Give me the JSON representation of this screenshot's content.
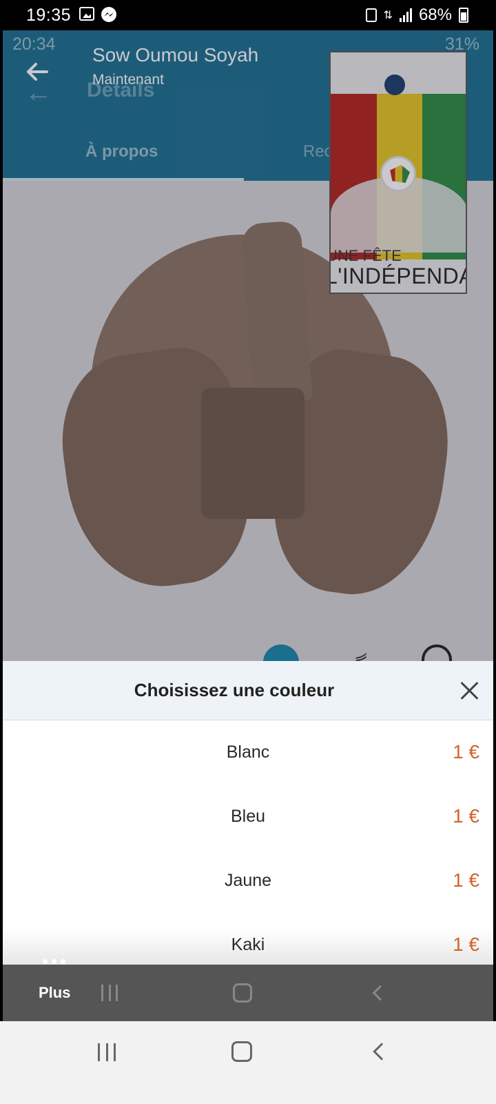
{
  "status_bar": {
    "time": "19:35",
    "battery": "68%",
    "icons": [
      "gallery-icon",
      "messenger-icon",
      "lock-icon",
      "data-icon",
      "signal-icon",
      "battery-icon"
    ]
  },
  "background_app": {
    "time": "20:34",
    "status_right": "31%",
    "header_title": "Details",
    "tabs": [
      "À propos",
      "Rec"
    ],
    "accent_color": "#1a6e8e"
  },
  "notification": {
    "sender": "Sow Oumou Soyah",
    "time": "Maintenant"
  },
  "pip_video": {
    "line1": "UNE FÊTE",
    "line2": "L'INDÉPENDAN"
  },
  "sheet": {
    "title": "Choisissez une couleur",
    "options": [
      {
        "name": "Blanc",
        "price": "1 €"
      },
      {
        "name": "Bleu",
        "price": "1 €"
      },
      {
        "name": "Jaune",
        "price": "1 €"
      },
      {
        "name": "Kaki",
        "price": "1 €"
      }
    ],
    "price_color": "#d0642a"
  },
  "inner_nav": {
    "more_label": "Plus"
  }
}
